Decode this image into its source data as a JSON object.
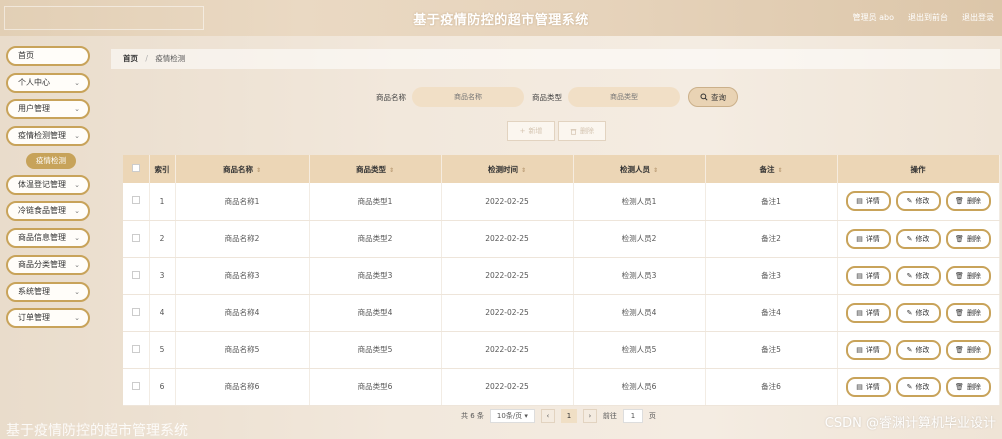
{
  "header": {
    "title": "基于疫情防控的超市管理系统",
    "user_label": "管理员 abo",
    "back_label": "退出到前台",
    "logout_label": "退出登录"
  },
  "sidebar": {
    "items": [
      {
        "label": "首页",
        "chevron": false
      },
      {
        "label": "个人中心",
        "chevron": true
      },
      {
        "label": "用户管理",
        "chevron": true
      },
      {
        "label": "疫情检测管理",
        "chevron": true
      }
    ],
    "active_sub": "疫情检测",
    "items_after": [
      {
        "label": "体温登记管理",
        "chevron": true
      },
      {
        "label": "冷链食品管理",
        "chevron": true
      },
      {
        "label": "商品信息管理",
        "chevron": true
      },
      {
        "label": "商品分类管理",
        "chevron": true
      },
      {
        "label": "系统管理",
        "chevron": true
      },
      {
        "label": "订单管理",
        "chevron": true
      }
    ]
  },
  "breadcrumb": {
    "home": "首页",
    "sep": "/",
    "current": "疫情检测"
  },
  "search": {
    "name_label": "商品名称",
    "name_placeholder": "商品名称",
    "type_label": "商品类型",
    "type_placeholder": "商品类型",
    "query_label": "查询"
  },
  "actions": {
    "add_label": "新增",
    "delete_label": "删除"
  },
  "table": {
    "columns": [
      "索引",
      "商品名称",
      "商品类型",
      "检测时间",
      "检测人员",
      "备注",
      "操作"
    ],
    "rows": [
      {
        "index": "1",
        "name": "商品名称1",
        "type": "商品类型1",
        "time": "2022-02-25",
        "person": "检测人员1",
        "note": "备注1"
      },
      {
        "index": "2",
        "name": "商品名称2",
        "type": "商品类型2",
        "time": "2022-02-25",
        "person": "检测人员2",
        "note": "备注2"
      },
      {
        "index": "3",
        "name": "商品名称3",
        "type": "商品类型3",
        "time": "2022-02-25",
        "person": "检测人员3",
        "note": "备注3"
      },
      {
        "index": "4",
        "name": "商品名称4",
        "type": "商品类型4",
        "time": "2022-02-25",
        "person": "检测人员4",
        "note": "备注4"
      },
      {
        "index": "5",
        "name": "商品名称5",
        "type": "商品类型5",
        "time": "2022-02-25",
        "person": "检测人员5",
        "note": "备注5"
      },
      {
        "index": "6",
        "name": "商品名称6",
        "type": "商品类型6",
        "time": "2022-02-25",
        "person": "检测人员6",
        "note": "备注6"
      }
    ],
    "op_detail": "详情",
    "op_edit": "修改",
    "op_delete": "删除"
  },
  "pagination": {
    "total": "共 6 条",
    "page_size": "10条/页",
    "current_page": "1",
    "goto_label": "前往",
    "goto_value": "1",
    "page_suffix": "页"
  },
  "watermark": {
    "footer": "基于疫情防控的超市管理系统",
    "csdn": "CSDN @睿渊计算机毕业设计"
  },
  "colors": {
    "accent": "#c8a35a",
    "header_bg": "#ecd6b6",
    "input_bg": "#f1dfc6"
  }
}
